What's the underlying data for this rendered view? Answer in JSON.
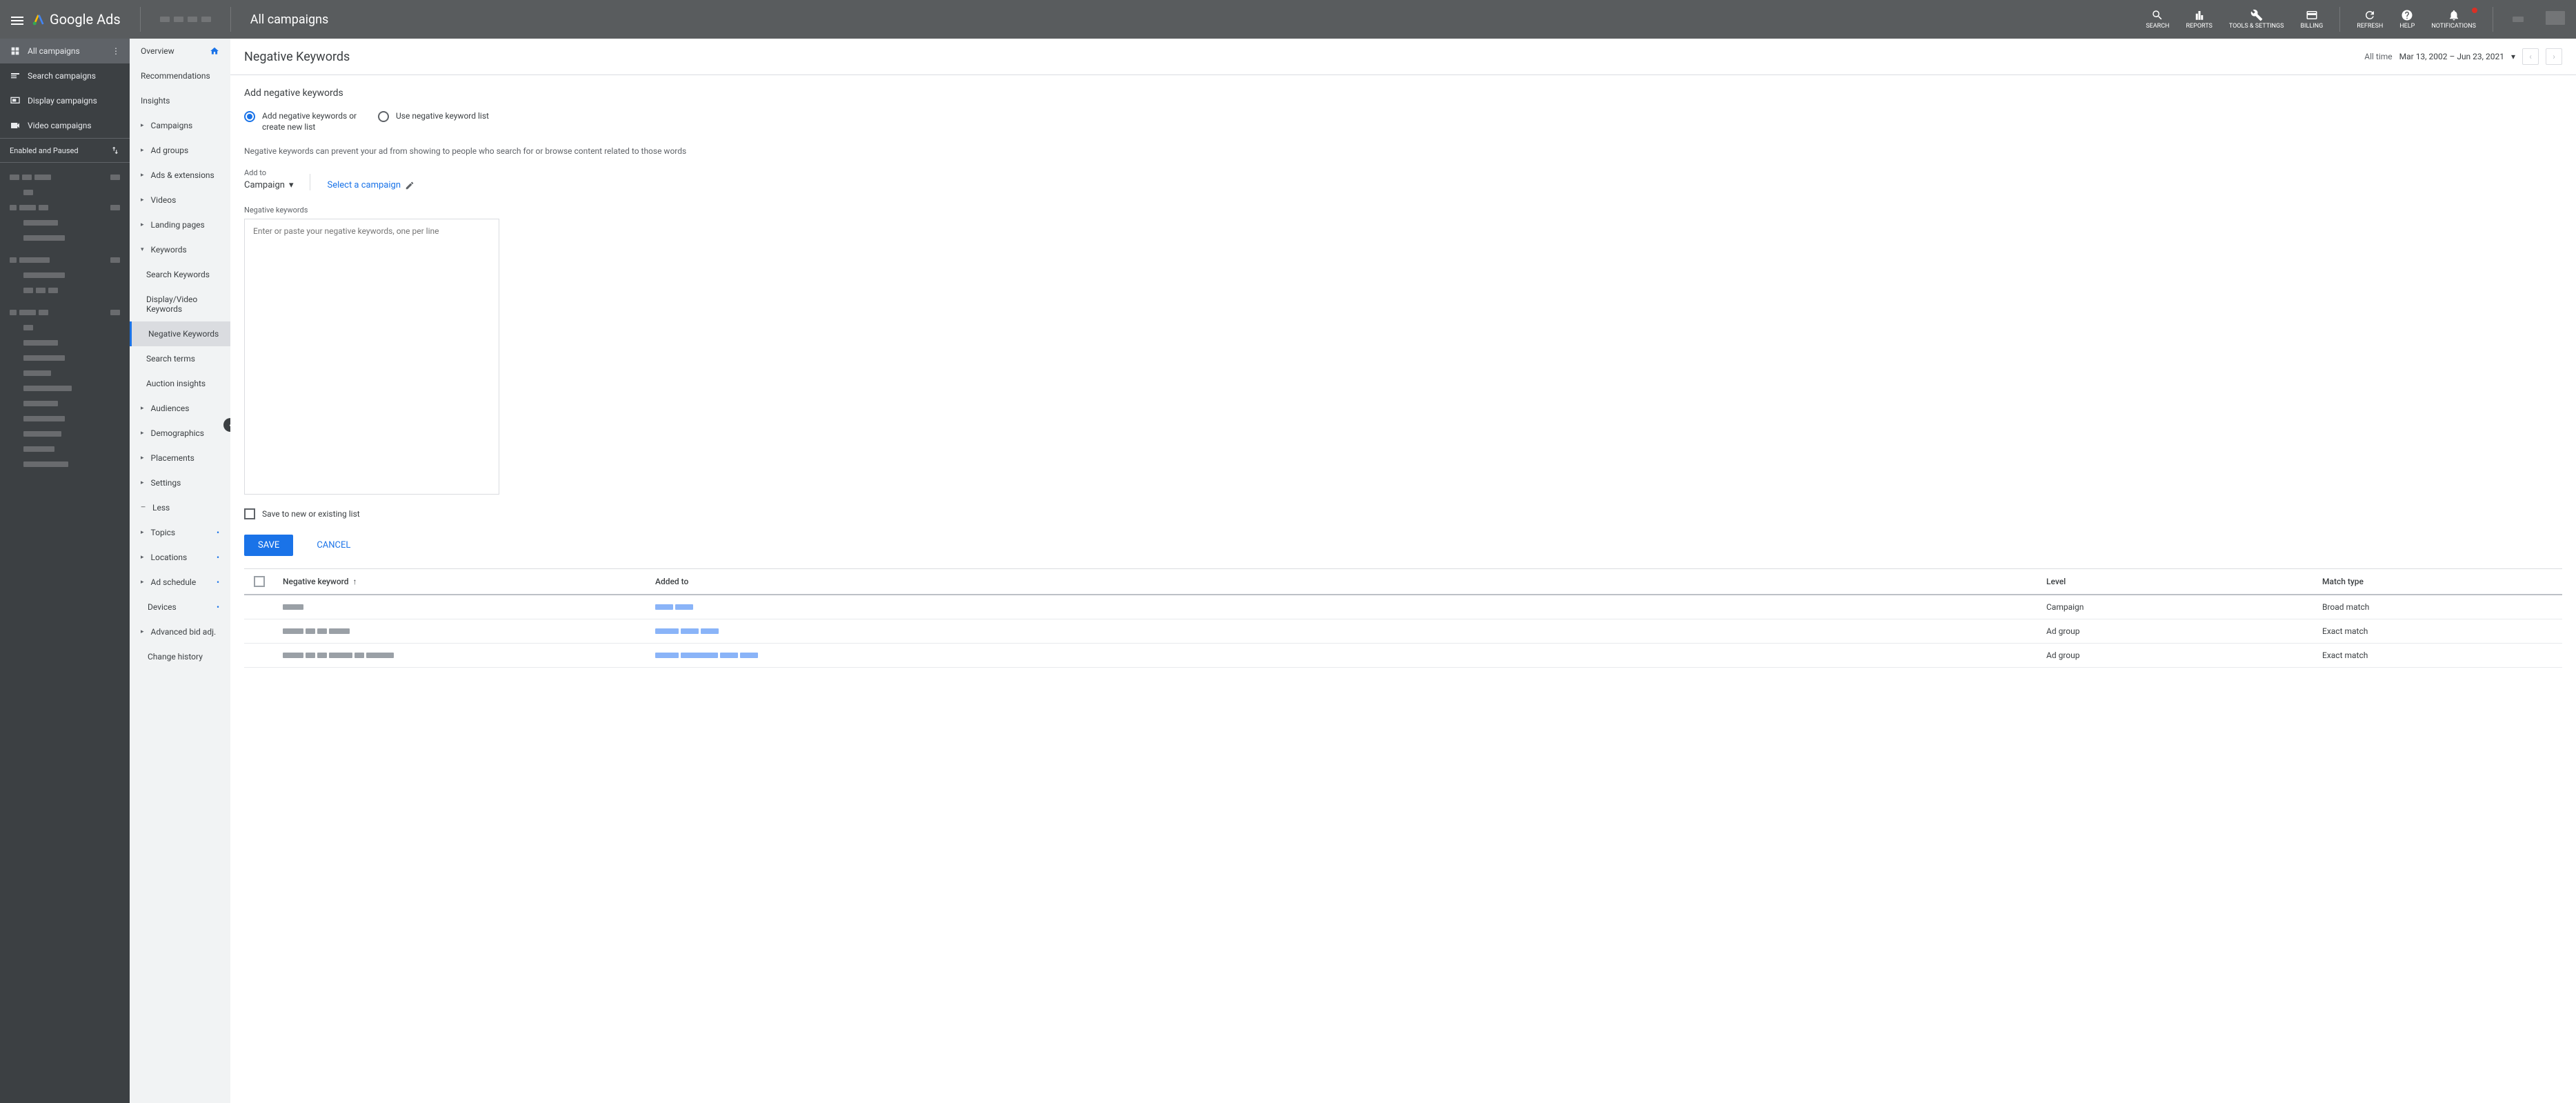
{
  "header": {
    "brand": "Google Ads",
    "scope_title": "All campaigns",
    "buttons": {
      "search": "SEARCH",
      "reports": "REPORTS",
      "tools": "TOOLS & SETTINGS",
      "billing": "BILLING",
      "refresh": "REFRESH",
      "help": "HELP",
      "notifications": "NOTIFICATIONS"
    }
  },
  "sidebar": {
    "items": [
      {
        "label": "All campaigns"
      },
      {
        "label": "Search campaigns"
      },
      {
        "label": "Display campaigns"
      },
      {
        "label": "Video campaigns"
      }
    ],
    "filter_label": "Enabled and Paused"
  },
  "nav2": {
    "overview": "Overview",
    "recommendations": "Recommendations",
    "insights": "Insights",
    "campaigns": "Campaigns",
    "ad_groups": "Ad groups",
    "ads_ext": "Ads & extensions",
    "videos": "Videos",
    "landing": "Landing pages",
    "keywords": "Keywords",
    "kw_sub": {
      "search": "Search Keywords",
      "display": "Display/Video Keywords",
      "negative": "Negative Keywords",
      "terms": "Search terms",
      "auction": "Auction insights"
    },
    "audiences": "Audiences",
    "demographics": "Demographics",
    "placements": "Placements",
    "settings": "Settings",
    "less": "Less",
    "topics": "Topics",
    "locations": "Locations",
    "ad_schedule": "Ad schedule",
    "devices": "Devices",
    "advanced_bid": "Advanced bid adj.",
    "change_history": "Change history"
  },
  "main": {
    "page_title": "Negative Keywords",
    "date": {
      "label": "All time",
      "range": "Mar 13, 2002 – Jun 23, 2021"
    },
    "section_title": "Add negative keywords",
    "radio1": "Add negative keywords or create new list",
    "radio2": "Use negative keyword list",
    "description": "Negative keywords can prevent your ad from showing to people who search for or browse content related to those words",
    "addto_label": "Add to",
    "addto_value": "Campaign",
    "select_campaign": "Select a campaign",
    "kw_label": "Negative keywords",
    "kw_placeholder": "Enter or paste your negative keywords, one per line",
    "save_list": "Save to new or existing list",
    "save_btn": "SAVE",
    "cancel_btn": "CANCEL"
  },
  "table": {
    "headers": {
      "kw": "Negative keyword",
      "added": "Added to",
      "level": "Level",
      "match": "Match type"
    },
    "rows": [
      {
        "level": "Campaign",
        "match": "Broad match"
      },
      {
        "level": "Ad group",
        "match": "Exact match"
      },
      {
        "level": "Ad group",
        "match": "Exact match"
      }
    ]
  }
}
